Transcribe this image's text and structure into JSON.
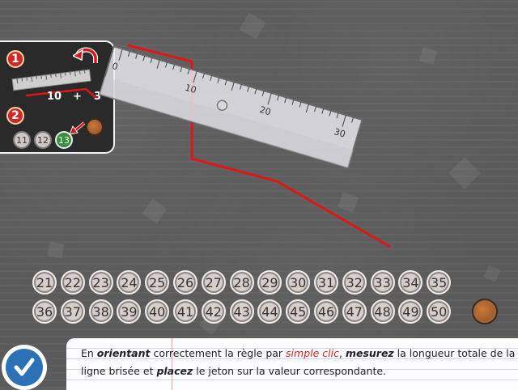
{
  "help": {
    "step1": "1",
    "step2": "2",
    "formula_a": "10",
    "formula_op": "+",
    "formula_b": "3",
    "chips": [
      "11",
      "12",
      "13"
    ],
    "selected_chip": "13"
  },
  "ruler": {
    "labels": [
      "0",
      "10",
      "20",
      "30"
    ]
  },
  "answers": {
    "row1": [
      "21",
      "22",
      "23",
      "24",
      "25",
      "26",
      "27",
      "28",
      "29",
      "30",
      "31",
      "32",
      "33",
      "34",
      "35"
    ],
    "row2": [
      "36",
      "37",
      "38",
      "39",
      "40",
      "41",
      "42",
      "43",
      "44",
      "45",
      "46",
      "47",
      "48",
      "49",
      "50"
    ]
  },
  "instructions": {
    "p1": "En ",
    "k1": "orientant",
    "p2": " correctement la règle par ",
    "k2": "simple clic",
    "p3": ", ",
    "k3": "mesurez",
    "p4": " la longueur totale de la ligne brisée et ",
    "k4": "placez",
    "p5": " le jeton sur la valeur correspondante."
  },
  "colors": {
    "line": "#e01515",
    "token": "#b0622c",
    "validate": "#2a71b6",
    "active_chip": "#3a8f3e"
  },
  "icons": {
    "validate": "checkmark-icon",
    "rotate": "rotate-arrow-icon"
  }
}
